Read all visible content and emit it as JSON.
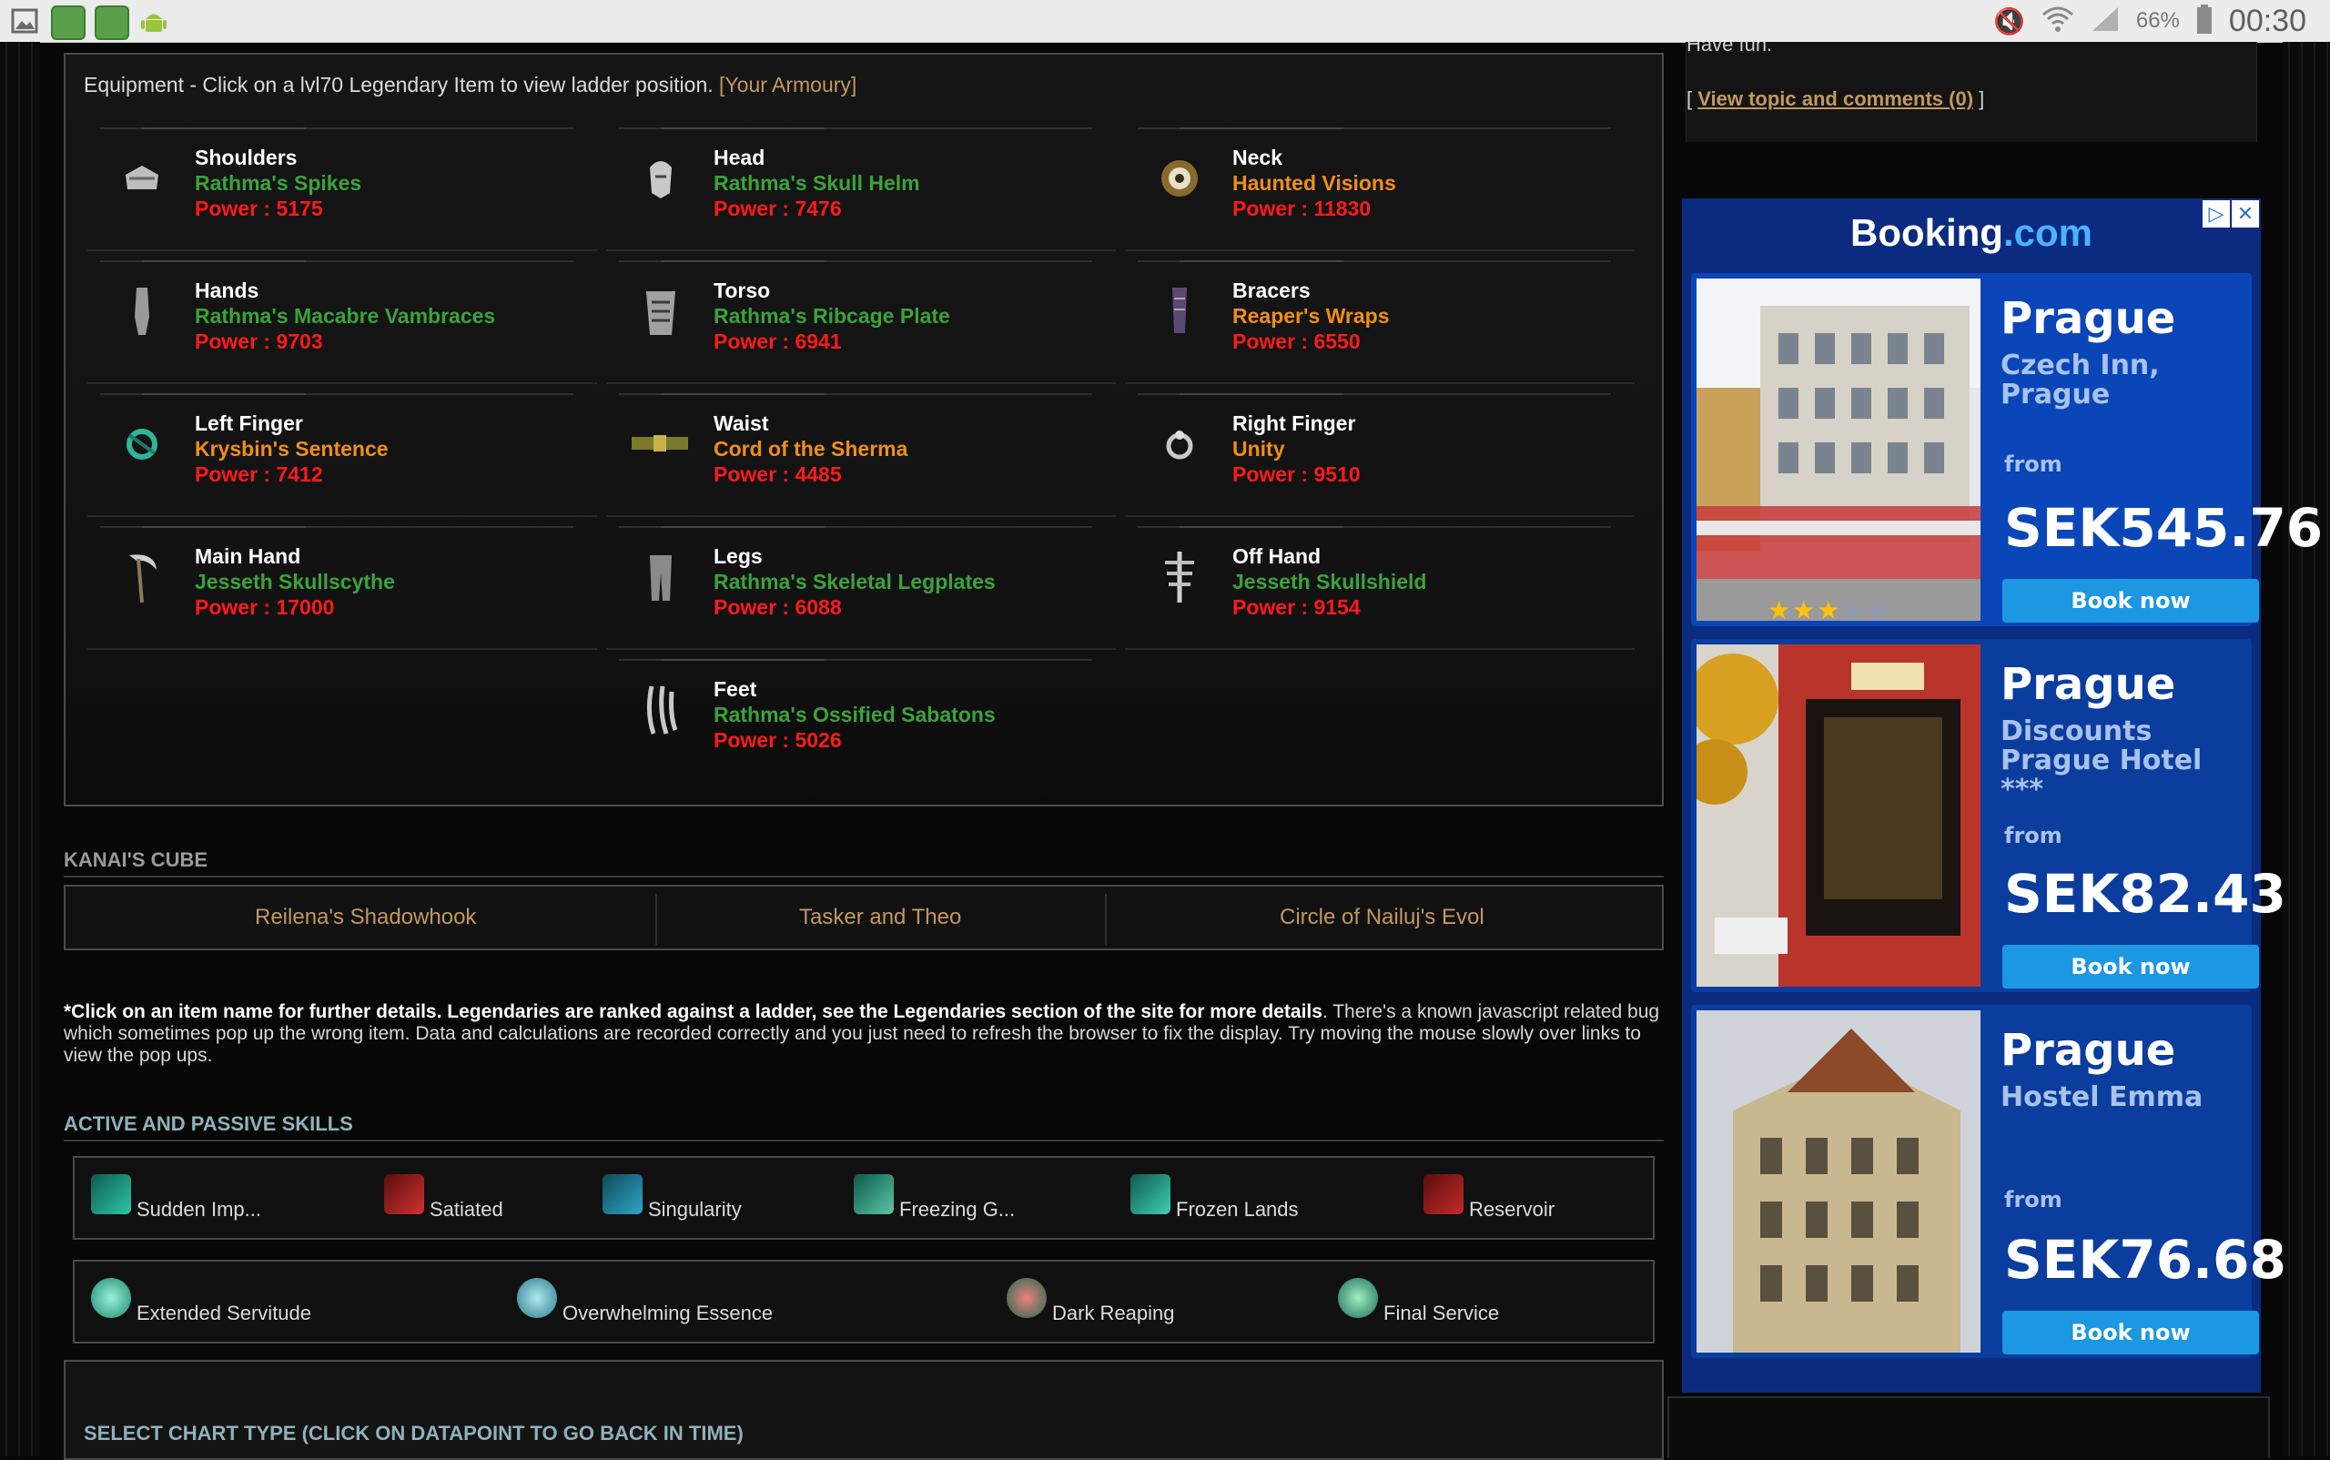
{
  "status_bar": {
    "battery": "66%",
    "time": "00:30"
  },
  "equipment": {
    "header": "Equipment - Click on a lvl70 Legendary Item to view ladder position.",
    "armoury_link": "[Your Armoury]",
    "slots": [
      {
        "slot": "Shoulders",
        "item": "Rathma's Spikes",
        "power": "Power : 5175",
        "rarity": "set"
      },
      {
        "slot": "Head",
        "item": "Rathma's Skull Helm",
        "power": "Power : 7476",
        "rarity": "set"
      },
      {
        "slot": "Neck",
        "item": "Haunted Visions",
        "power": "Power : 11830",
        "rarity": "legendary"
      },
      {
        "slot": "Hands",
        "item": "Rathma's Macabre Vambraces",
        "power": "Power : 9703",
        "rarity": "set"
      },
      {
        "slot": "Torso",
        "item": "Rathma's Ribcage Plate",
        "power": "Power : 6941",
        "rarity": "set"
      },
      {
        "slot": "Bracers",
        "item": "Reaper's Wraps",
        "power": "Power : 6550",
        "rarity": "legendary"
      },
      {
        "slot": "Left Finger",
        "item": "Krysbin's Sentence",
        "power": "Power : 7412",
        "rarity": "legendary"
      },
      {
        "slot": "Waist",
        "item": "Cord of the Sherma",
        "power": "Power : 4485",
        "rarity": "legendary"
      },
      {
        "slot": "Right Finger",
        "item": "Unity",
        "power": "Power : 9510",
        "rarity": "legendary"
      },
      {
        "slot": "Main Hand",
        "item": "Jesseth Skullscythe",
        "power": "Power : 17000",
        "rarity": "set"
      },
      {
        "slot": "Legs",
        "item": "Rathma's Skeletal Legplates",
        "power": "Power : 6088",
        "rarity": "set"
      },
      {
        "slot": "Off Hand",
        "item": "Jesseth Skullshield",
        "power": "Power : 9154",
        "rarity": "set"
      },
      {
        "slot": "Feet",
        "item": "Rathma's Ossified Sabatons",
        "power": "Power : 5026",
        "rarity": "set"
      }
    ]
  },
  "kanais_cube": {
    "title": "KANAI'S CUBE",
    "items": [
      "Reilena's Shadowhook",
      "Tasker and Theo",
      "Circle of Nailuj's Evol"
    ]
  },
  "note": {
    "bold": "*Click on an item name for further details. Legendaries are ranked against a ladder, see the Legendaries section of the site for more details",
    "rest": ". There's a known javascript related bug which sometimes pop up the wrong item. Data and calculations are recorded correctly and you just need to refresh the browser to fix the display. Try moving the mouse slowly over links to view the pop ups."
  },
  "skills": {
    "title": "ACTIVE AND PASSIVE SKILLS",
    "active": [
      "Sudden Imp...",
      "Satiated",
      "Singularity",
      "Freezing G...",
      "Frozen Lands",
      "Reservoir"
    ],
    "passive": [
      "Extended Servitude",
      "Overwhelming Essence",
      "Dark Reaping",
      "Final Service"
    ]
  },
  "chart_section": {
    "title": "SELECT CHART TYPE (CLICK ON DATAPOINT TO GO BACK IN TIME)"
  },
  "sidebar": {
    "have_fun": "Have fun.",
    "bracket_open": "[",
    "view_topic": "View topic and comments (0)",
    "bracket_close": "]"
  },
  "ad": {
    "brand_main": "Booking",
    "brand_tld": ".com",
    "cards": [
      {
        "city": "Prague",
        "hotel": "Czech Inn, Prague",
        "from": "from",
        "price": "SEK545.76",
        "button": "Book now",
        "stars": "★★★",
        "stars_off": "★★"
      },
      {
        "city": "Prague",
        "hotel": "Discounts Prague Hotel ***",
        "from": "from",
        "price": "SEK82.43",
        "button": "Book now"
      },
      {
        "city": "Prague",
        "hotel": "Hostel Emma",
        "from": "from",
        "price": "SEK76.68",
        "button": "Book now"
      }
    ]
  },
  "colors": {
    "set_item": "#3aa33a",
    "legendary_item": "#f08e1a",
    "power": "#ff1a1a",
    "link": "#c2985f",
    "ad_background": "#0a2b80",
    "ad_button": "#1c98e2"
  }
}
